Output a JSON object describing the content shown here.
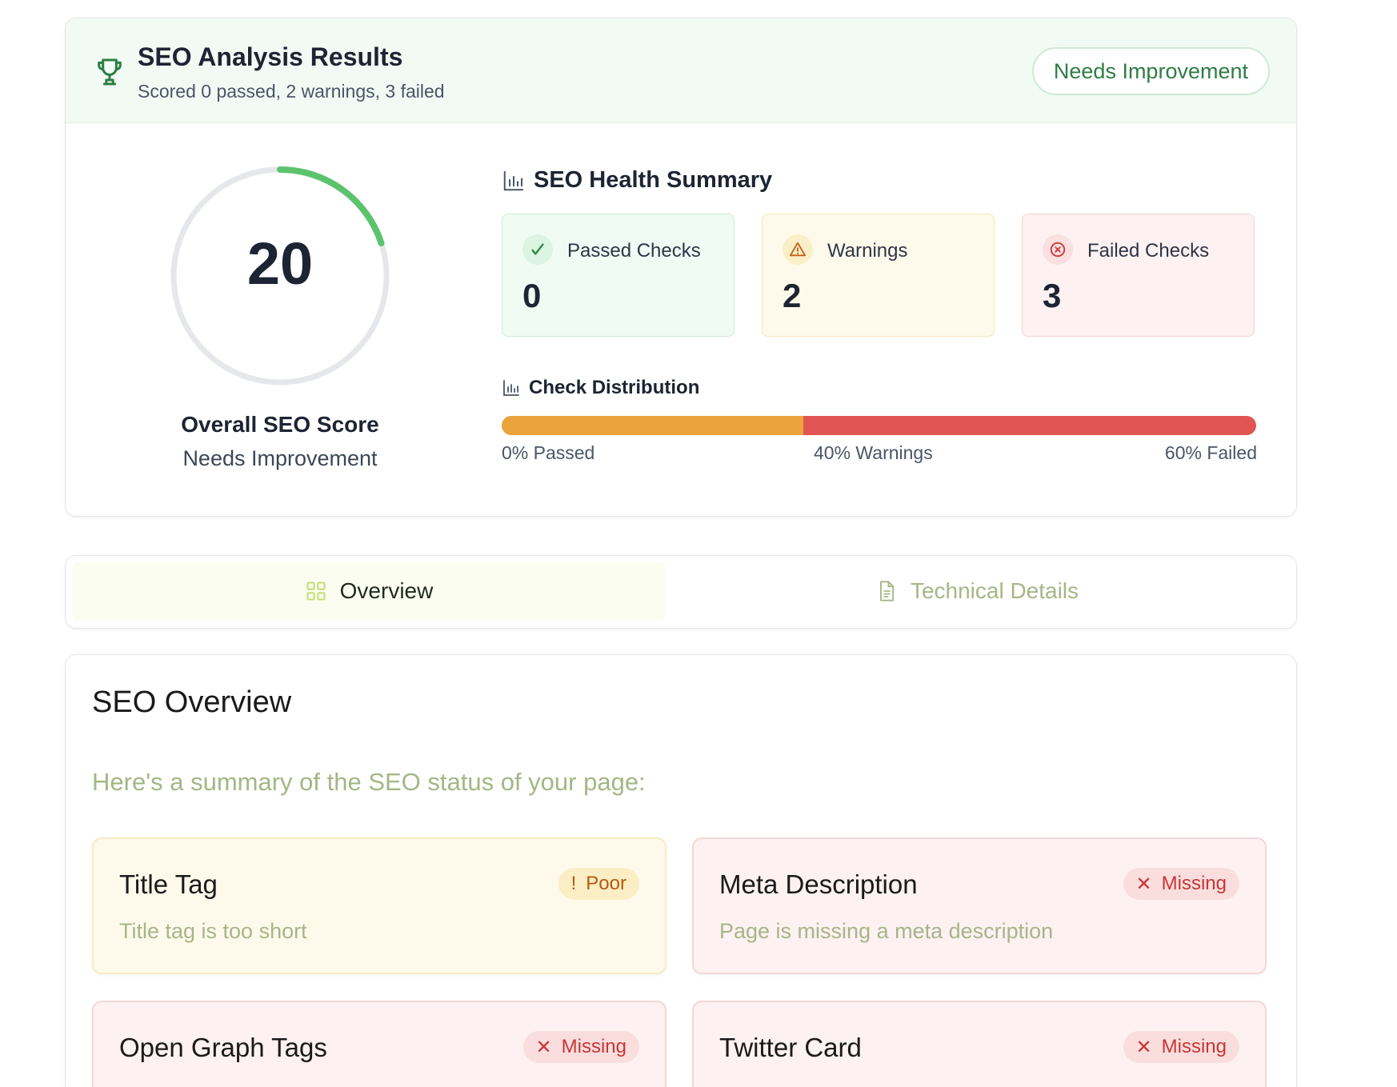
{
  "results": {
    "title": "SEO Analysis Results",
    "subtitle": "Scored 0 passed, 2 warnings, 3 failed",
    "status": "Needs Improvement",
    "score": "20",
    "score_fraction": 0.2,
    "score_label": "Overall SEO Score",
    "score_status": "Needs Improvement",
    "health_title": "SEO Health Summary",
    "stats": {
      "passed": {
        "label": "Passed Checks",
        "value": "0"
      },
      "warnings": {
        "label": "Warnings",
        "value": "2"
      },
      "failed": {
        "label": "Failed Checks",
        "value": "3"
      }
    },
    "distribution": {
      "title": "Check Distribution",
      "passed_pct": 0,
      "warnings_pct": 40,
      "failed_pct": 60,
      "passed_label": "0% Passed",
      "warnings_label": "40% Warnings",
      "failed_label": "60% Failed"
    },
    "colors": {
      "green": "#5cc36d",
      "warn": "#eba33c",
      "fail": "#e05552"
    }
  },
  "tabs": [
    {
      "label": "Overview",
      "icon": "grid-icon",
      "active": true
    },
    {
      "label": "Technical Details",
      "icon": "document-icon",
      "active": false
    }
  ],
  "overview": {
    "title": "SEO Overview",
    "subtitle": "Here's a summary of the SEO status of your page:",
    "items": [
      {
        "title": "Title Tag",
        "badge": "Poor",
        "badge_icon": "!",
        "description": "Title tag is too short"
      },
      {
        "title": "Meta Description",
        "badge": "Missing",
        "badge_icon": "✕",
        "description": "Page is missing a meta description"
      },
      {
        "title": "Open Graph Tags",
        "badge": "Missing",
        "badge_icon": "✕"
      },
      {
        "title": "Twitter Card",
        "badge": "Missing",
        "badge_icon": "✕"
      }
    ]
  }
}
